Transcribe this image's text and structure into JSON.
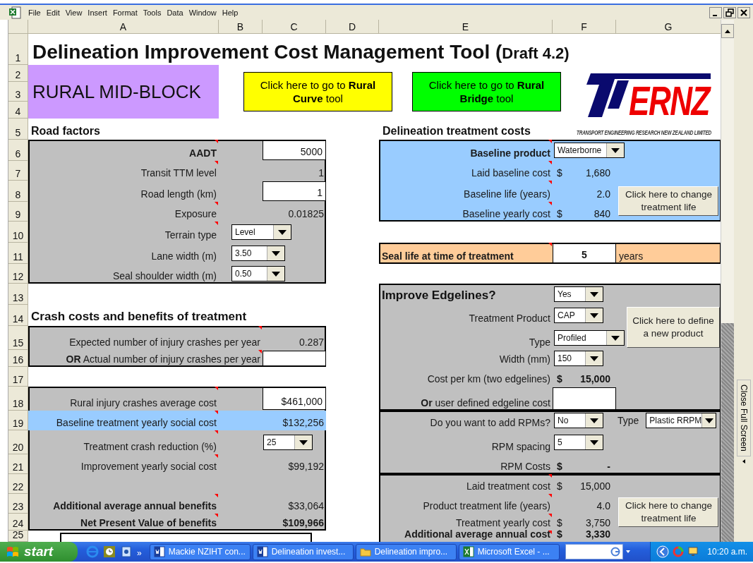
{
  "menu": [
    "File",
    "Edit",
    "View",
    "Insert",
    "Format",
    "Tools",
    "Data",
    "Window",
    "Help"
  ],
  "columns": [
    "A",
    "B",
    "C",
    "D",
    "E",
    "F",
    "G"
  ],
  "rows": [
    "1",
    "2",
    "3",
    "4",
    "5",
    "6",
    "7",
    "8",
    "9",
    "10",
    "11",
    "12",
    "13",
    "14",
    "15",
    "16",
    "17",
    "18",
    "19",
    "20",
    "21",
    "22",
    "23",
    "24",
    "25"
  ],
  "title": "Delineation Improvement Cost Management Tool (",
  "title_suffix": "Draft 4.2)",
  "section_label": "RURAL MID-BLOCK",
  "nav_buttons": [
    {
      "text": "Click here to go to **Rural Curve** tool",
      "color": "#ffff00"
    },
    {
      "text": "Click here to go to **Rural Bridge** tool",
      "color": "#00ff00"
    }
  ],
  "logo": {
    "name": "ERNZ",
    "tagline": "TRANSPORT ENGINEERING RESEARCH NEW ZEALAND LIMITED"
  },
  "road_factors": {
    "heading": "Road factors",
    "rows": [
      {
        "label": "AADT",
        "bold": true,
        "kind": "input",
        "value": "5000",
        "comment": true
      },
      {
        "label": "Transit TTM level",
        "kind": "value",
        "value": "1",
        "comment": true
      },
      {
        "label": "Road length (km)",
        "kind": "input",
        "value": "1",
        "comment": false
      },
      {
        "label": "Exposure",
        "kind": "value",
        "value": "0.01825",
        "comment": true
      },
      {
        "label": "Terrain type",
        "kind": "dropdown",
        "value": "Level",
        "comment": true
      },
      {
        "label": "Lane width (m)",
        "kind": "dropdown",
        "value": "3.50",
        "comment": false
      },
      {
        "label": "Seal shoulder width (m)",
        "kind": "dropdown",
        "value": "0.50",
        "comment": false
      }
    ]
  },
  "crash_costs": {
    "heading": "Crash costs and benefits of treatment",
    "expected": [
      {
        "label": "Expected number of injury crashes per year",
        "kind": "value",
        "value": "0.287",
        "comment": true
      },
      {
        "label": "**OR** Actual number of injury crashes per year",
        "kind": "input",
        "comment": true
      }
    ],
    "costs": [
      {
        "label": "Rural injury crashes average cost",
        "kind": "input",
        "value": "$461,000",
        "comment": true,
        "highlight": false
      },
      {
        "label": "Baseline treatment yearly social cost",
        "kind": "value",
        "value": "$132,256",
        "comment": true,
        "highlight": true
      },
      {
        "label": "Treatment crash reduction (%)",
        "kind": "dropdown",
        "value": "25",
        "comment": true,
        "highlight": false
      },
      {
        "label": "Improvement yearly social cost",
        "kind": "value",
        "value": "$99,192",
        "comment": true,
        "highlight": false
      }
    ],
    "benefits": [
      {
        "label": "Additional average annual benefits",
        "bold": true,
        "kind": "value",
        "value": "$33,064",
        "comment": true
      },
      {
        "label": "Net Present Value of benefits",
        "bold": true,
        "kind": "value",
        "value": "$109,966",
        "value_bold": true,
        "comment": true
      }
    ]
  },
  "treatment_costs": {
    "heading": "Delineation treatment costs",
    "baseline": {
      "rows": [
        {
          "label": "Baseline product",
          "bold": true,
          "kind": "dropdown",
          "value": "Waterborne",
          "comment": true
        },
        {
          "label": "Laid baseline cost",
          "kind": "value",
          "currency": "$",
          "value": "1,680",
          "comment": true
        },
        {
          "label": "Baseline life (years)",
          "kind": "value",
          "value": "2.0",
          "comment": true
        },
        {
          "label": "Baseline yearly cost",
          "kind": "value",
          "currency": "$",
          "value": "840",
          "comment": true
        }
      ],
      "button": "Click here to change treatment life"
    },
    "seal_life": {
      "label": "Seal life at time of treatment",
      "value": "5",
      "unit": "years",
      "comment": true
    },
    "edgelines": {
      "heading": "Improve Edgelines?",
      "choice": "Yes",
      "rows": [
        {
          "label": "Treatment Product",
          "kind": "dropdown",
          "value": "CAP",
          "comment": false
        },
        {
          "label": "Type",
          "kind": "dropdown",
          "value": "Profiled",
          "comment": false
        },
        {
          "label": "Width (mm)",
          "kind": "dropdown",
          "value": "150",
          "comment": false
        },
        {
          "label": "Cost per km (two edgelines)",
          "kind": "value",
          "currency": "$",
          "value": "15,000",
          "value_bold": true,
          "comment": false
        },
        {
          "label": "**Or** user defined edgeline cost",
          "kind": "input",
          "comment": false
        }
      ],
      "button": "Click here to define a new product"
    },
    "rpms": {
      "rows": [
        {
          "label": "Do you want to add RPMs?",
          "kind": "dropdown",
          "value": "No",
          "comment": false
        },
        {
          "label": "RPM spacing",
          "kind": "dropdown",
          "value": "5",
          "comment": false
        },
        {
          "label": "RPM Costs",
          "kind": "value",
          "currency": "$",
          "value": "-",
          "value_bold": true,
          "comment": false
        }
      ],
      "type_label": "Type",
      "type_value": "Plastic RRPM"
    },
    "totals": {
      "rows": [
        {
          "label": "Laid treatment cost",
          "kind": "value",
          "currency": "$",
          "value": "15,000",
          "comment": true
        },
        {
          "label": "Product treatment life (years)",
          "kind": "value",
          "value": "4.0",
          "comment": true
        },
        {
          "label": "Treatment yearly cost",
          "kind": "value",
          "currency": "$",
          "value": "3,750",
          "comment": true
        },
        {
          "label": "Additional average annual cost",
          "bold": true,
          "kind": "value",
          "currency": "$",
          "value": "3,330",
          "value_bold": true,
          "comment": true
        }
      ],
      "button": "Click here to change treatment life"
    }
  },
  "side_panel": {
    "label": "Close Full Screen"
  },
  "taskbar": {
    "start": "start",
    "overflow": "»",
    "tasks": [
      {
        "label": "Mackie NZIHT con...",
        "kind": "document"
      },
      {
        "label": "Delineation invest...",
        "kind": "document"
      },
      {
        "label": "Delineation impro...",
        "kind": "folder"
      },
      {
        "label": "Microsoft Excel - ...",
        "kind": "spreadsheet"
      }
    ],
    "clock": "10:20 a.m."
  }
}
